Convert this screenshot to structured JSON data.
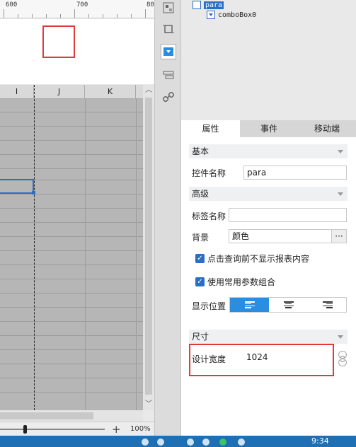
{
  "ruler": {
    "labels": [
      "600",
      "700",
      "80"
    ]
  },
  "sheet": {
    "columns": [
      "I",
      "J",
      "K"
    ]
  },
  "zoom": {
    "value": "100%",
    "plus": "+"
  },
  "toolbar": {
    "icons": [
      "widget-icon",
      "frame-icon",
      "combo-icon",
      "layer-icon",
      "link-icon"
    ]
  },
  "tree": {
    "root_label": "para",
    "child_label": "comboBox0"
  },
  "tabs": [
    "属性",
    "事件",
    "移动端"
  ],
  "props": {
    "basic_section": "基本",
    "control_name_label": "控件名称",
    "control_name_value": "para",
    "advanced_section": "高级",
    "tag_name_label": "标签名称",
    "tag_name_value": "",
    "background_label": "背景",
    "background_value": "颜色",
    "background_more": "···",
    "checkbox1_label": "点击查询前不显示报表内容",
    "checkbox2_label": "使用常用参数组合",
    "position_label": "显示位置",
    "size_section": "尺寸",
    "design_width_label": "设计宽度",
    "design_width_value": "1024"
  },
  "taskbar": {
    "clock": "9:34"
  },
  "colors": {
    "accent": "#2a8de0",
    "highlight": "#e03a3a"
  }
}
